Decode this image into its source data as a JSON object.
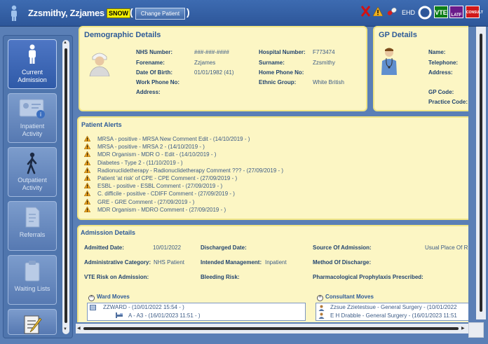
{
  "header": {
    "patient_name": "Zzsmithy, Zzjames",
    "badge": "SNOW",
    "change_patient_label": "Change Patient",
    "paren_open": "(",
    "paren_close": ")",
    "ehd_label": "EHD",
    "vte_label": "VTE",
    "latf_label": "LATF",
    "consult_label": "CONSULT"
  },
  "sidebar": {
    "items": [
      {
        "label_1": "Current",
        "label_2": "Admission",
        "icon": "person-icon",
        "active": true
      },
      {
        "label_1": "Inpatient",
        "label_2": "Activity",
        "icon": "id-card-icon",
        "active": false
      },
      {
        "label_1": "Outpatient",
        "label_2": "Activity",
        "icon": "walking-person-icon",
        "active": false
      },
      {
        "label_1": "Referrals",
        "label_2": "",
        "icon": "document-icon",
        "active": false
      },
      {
        "label_1": "Waiting Lists",
        "label_2": "",
        "icon": "clipboard-icon",
        "active": false
      },
      {
        "label_1": "",
        "label_2": "",
        "icon": "notepad-icon",
        "active": false
      }
    ]
  },
  "demographics": {
    "title": "Demographic Details",
    "nhs_label": "NHS Number:",
    "nhs_value": "###-###-####",
    "forename_label": "Forename:",
    "forename_value": "Zzjames",
    "dob_label": "Date Of Birth:",
    "dob_value": "01/01/1982 (41)",
    "work_phone_label": "Work Phone No:",
    "work_phone_value": "",
    "address_label": "Address:",
    "address_value": "",
    "hospital_label": "Hospital Number:",
    "hospital_value": "F773474",
    "surname_label": "Surname:",
    "surname_value": "Zzsmithy",
    "home_phone_label": "Home Phone No:",
    "home_phone_value": "",
    "ethnic_label": "Ethnic Group:",
    "ethnic_value": "White British"
  },
  "gp": {
    "title": "GP Details",
    "name_label": "Name:",
    "telephone_label": "Telephone:",
    "address_label": "Address:",
    "gp_code_label": "GP Code:",
    "practice_code_label": "Practice Code:"
  },
  "alerts": {
    "title": "Patient Alerts",
    "items": [
      "MRSA - positive  -  MRSA New Comment Edit  -  (14/10/2019  -  )",
      "MRSA - positive  -  MRSA 2  -  (14/10/2019  -  )",
      "MDR Organism  -  MDR O - Edit  -  (14/10/2019  -  )",
      "Diabetes  -  Type 2  -  (11/10/2019  -  )",
      "Radionuclidetherapy  -  Radionuclidetherapy Comment ???  -  (27/09/2019  -  )",
      "Patient 'at risk' of CPE  -  CPE Comment  -  (27/09/2019  -  )",
      "ESBL - positive  -  ESBL Comment  -  (27/09/2019  -  )",
      "C. difficile - positive  -  CDIFF Comment  -  (27/09/2019  -  )",
      "GRE  -  GRE Comment  -  (27/09/2019  -  )",
      "MDR Organism  -  MDRO Comment  -  (27/09/2019  -  )"
    ]
  },
  "admission": {
    "title": "Admission Details",
    "admitted_label": "Admitted Date:",
    "admitted_value": "10/01/2022",
    "discharged_label": "Discharged Date:",
    "source_label": "Source Of Admission:",
    "source_value": "Usual Place Of R",
    "admin_cat_label": "Administrative Category:",
    "admin_cat_value": "NHS Patient",
    "intended_label": "Intended Management:",
    "intended_value": "Inpatient",
    "method_label": "Method Of Discharge:",
    "vte_label": "VTE Risk on Admission:",
    "bleeding_label": "Bleeding Risk:",
    "pharm_label": "Pharmacological Prophylaxis Prescribed:",
    "ward_moves": {
      "title": "Ward Moves",
      "collapse_glyph": "^",
      "rows": [
        "ZZWARD  -  (10/01/2022 15:54  -  )",
        "A  -  A3  -  (16/01/2023 11:51  -  )"
      ]
    },
    "consultant_moves": {
      "title": "Consultant Moves",
      "rows": [
        "Zzsue Zzietestsue  -  General Surgery  -  (10/01/2022",
        "E H Drabble  -  General Surgery  -  (16/01/2023 11:51"
      ]
    }
  },
  "colors": {
    "header_bg": "#3d6bb1",
    "panel_bg": "#fcf6c4",
    "panel_border": "#f0e586",
    "title_blue": "#2e5b98",
    "badge_yellow": "#f4f000",
    "alert_orange": "#e8a020"
  }
}
